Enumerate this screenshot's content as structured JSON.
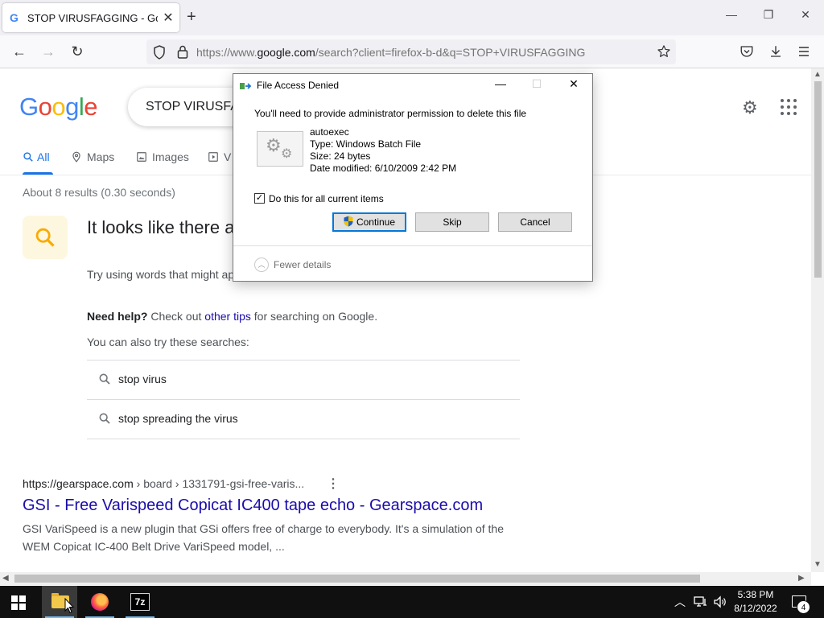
{
  "browser": {
    "tab_favicon": "G",
    "tab_title": "STOP VIRUSFAGGING - Google Search",
    "tab_close": "✕",
    "new_tab": "+",
    "window_minimize": "—",
    "window_restore": "❐",
    "window_close": "✕",
    "back": "←",
    "forward": "→",
    "reload": "↻",
    "url_prefix": "https://www.",
    "url_domain": "google.com",
    "url_rest": "/search?client=firefox-b-d&q=STOP+VIRUSFAGGING",
    "icons": [
      "back-icon",
      "forward-icon",
      "reload-icon",
      "shield-icon",
      "lock-icon",
      "star-icon",
      "pocket-icon",
      "download-icon",
      "menu-icon"
    ]
  },
  "google": {
    "logo_letters": [
      "G",
      "o",
      "o",
      "g",
      "l",
      "e"
    ],
    "logo_colors": [
      "#4285f4",
      "#ea4335",
      "#fbbc05",
      "#4285f4",
      "#34a853",
      "#ea4335"
    ],
    "search_query": "STOP VIRUSFAGGING",
    "tabs": [
      {
        "label": "All",
        "icon": "search-icon"
      },
      {
        "label": "Maps",
        "icon": "map-pin-icon"
      },
      {
        "label": "Images",
        "icon": "image-icon"
      },
      {
        "label": "V",
        "icon": "video-icon"
      }
    ],
    "result_stats": "About 8 results (0.30 seconds)",
    "no_results_title": "It looks like there a search",
    "no_results_body": "Try using words that might ap recipes\" instead of \"how to make a cake.\"",
    "need_help_label": "Need help?",
    "need_help_pre": " Check out ",
    "need_help_link": "other tips",
    "need_help_post": " for searching on Google.",
    "also_try": "You can also try these searches:",
    "suggestions": [
      "stop virus",
      "stop spreading the virus"
    ],
    "result": {
      "url_host": "https://gearspace.com",
      "url_path": " › board › 1331791-gsi-free-varis...",
      "title": "GSI - Free Varispeed Copicat IC400 tape echo - Gearspace.com",
      "snippet": "GSI VariSpeed is a new plugin that GSi offers free of charge to everybody. It's a simulation of the WEM Copicat IC-400 Belt Drive VariSpeed model, ..."
    }
  },
  "dialog": {
    "title": "File Access Denied",
    "minimize": "—",
    "maximize": "☐",
    "close": "✕",
    "message": "You'll need to provide administrator permission to delete this file",
    "file_name": "autoexec",
    "file_type": "Type: Windows Batch File",
    "file_size": "Size: 24 bytes",
    "file_modified": "Date modified: 6/10/2009 2:42 PM",
    "checkbox_checked": true,
    "checkbox_mark": "✓",
    "checkbox_label": "Do this for all current items",
    "btn_continue": "Continue",
    "btn_skip": "Skip",
    "btn_cancel": "Cancel",
    "fewer_details": "Fewer details"
  },
  "taskbar": {
    "apps": [
      "file-explorer",
      "firefox",
      "7-zip"
    ],
    "sevenzip_label": "7z",
    "tray_up": "︿",
    "time": "5:38 PM",
    "date": "8/12/2022",
    "notification_count": "4"
  }
}
